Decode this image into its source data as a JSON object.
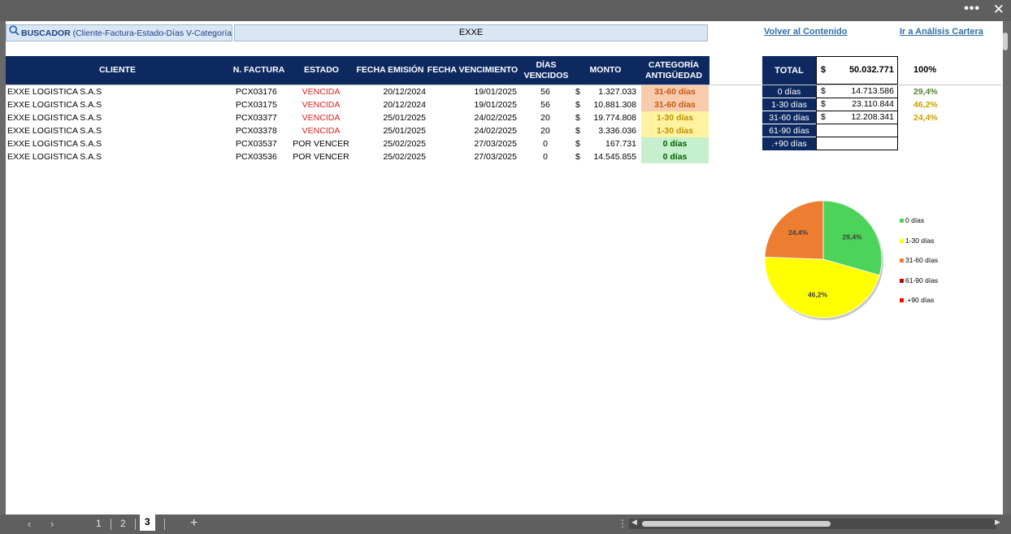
{
  "window": {
    "more_label": "•••",
    "close_label": "✕"
  },
  "search": {
    "label_bold": "BUSCADOR",
    "label_rest": " (Cliente-Factura-Estado-Días V-Categoría)",
    "value": "EXXE"
  },
  "links": {
    "back": "Volver al Contenido",
    "analysis": "Ir a Análisis Cartera"
  },
  "table": {
    "headers": {
      "cliente": "CLIENTE",
      "factura": "N. FACTURA",
      "estado": "ESTADO",
      "emision": "FECHA EMISIÓN",
      "vencimiento": "FECHA VENCIMIENTO",
      "dias": "DÍAS VENCIDOS",
      "monto": "MONTO",
      "categoria": "CATEGORÍA ANTIGÜEDAD"
    },
    "rows": [
      {
        "cliente": "EXXE LOGISTICA S.A.S",
        "factura": "PCX03176",
        "estado": "VENCIDA",
        "emision": "20/12/2024",
        "vencimiento": "19/01/2025",
        "dias": "56",
        "currency": "$",
        "monto": "1.327.033",
        "categoria": "31-60 días",
        "cat_bg": "#f8cbad",
        "cat_fg": "#c65a11"
      },
      {
        "cliente": "EXXE LOGISTICA S.A.S",
        "factura": "PCX03175",
        "estado": "VENCIDA",
        "emision": "20/12/2024",
        "vencimiento": "19/01/2025",
        "dias": "56",
        "currency": "$",
        "monto": "10.881.308",
        "categoria": "31-60 días",
        "cat_bg": "#f8cbad",
        "cat_fg": "#c65a11"
      },
      {
        "cliente": "EXXE LOGISTICA S.A.S",
        "factura": "PCX03377",
        "estado": "VENCIDA",
        "emision": "25/01/2025",
        "vencimiento": "24/02/2025",
        "dias": "20",
        "currency": "$",
        "monto": "19.774.808",
        "categoria": "1-30 días",
        "cat_bg": "#fff2a0",
        "cat_fg": "#bf9000"
      },
      {
        "cliente": "EXXE LOGISTICA S.A.S",
        "factura": "PCX03378",
        "estado": "VENCIDA",
        "emision": "25/01/2025",
        "vencimiento": "24/02/2025",
        "dias": "20",
        "currency": "$",
        "monto": "3.336.036",
        "categoria": "1-30 días",
        "cat_bg": "#fff2a0",
        "cat_fg": "#bf9000"
      },
      {
        "cliente": "EXXE LOGISTICA S.A.S",
        "factura": "PCX03537",
        "estado": "POR VENCER",
        "emision": "25/02/2025",
        "vencimiento": "27/03/2025",
        "dias": "0",
        "currency": "$",
        "monto": "167.731",
        "categoria": "0 días",
        "cat_bg": "#c6efce",
        "cat_fg": "#006100"
      },
      {
        "cliente": "EXXE LOGISTICA S.A.S",
        "factura": "PCX03536",
        "estado": "POR VENCER",
        "emision": "25/02/2025",
        "vencimiento": "27/03/2025",
        "dias": "0",
        "currency": "$",
        "monto": "14.545.855",
        "categoria": "0 días",
        "cat_bg": "#c6efce",
        "cat_fg": "#006100"
      }
    ]
  },
  "summary": {
    "total_label": "TOTAL",
    "currency": "$",
    "total_value": "50.032.771",
    "total_pct": "100%",
    "rows": [
      {
        "label": "0 días",
        "currency": "$",
        "value": "14.713.586",
        "pct": "29,4%",
        "pct_color": "#548235"
      },
      {
        "label": "1-30 días",
        "currency": "$",
        "value": "23.110.844",
        "pct": "46,2%",
        "pct_color": "#c9a000"
      },
      {
        "label": "31-60 días",
        "currency": "$",
        "value": "12.208.341",
        "pct": "24,4%",
        "pct_color": "#c9a000"
      },
      {
        "label": "61-90 días",
        "currency": "",
        "value": "",
        "pct": ""
      },
      {
        "label": ".+90 días",
        "currency": "",
        "value": "",
        "pct": ""
      }
    ]
  },
  "chart_data": {
    "type": "pie",
    "labels": [
      "0 días",
      "1-30 días",
      "31-60 días",
      "61-90 días",
      ".+90 días"
    ],
    "values": [
      29.4,
      46.2,
      24.4,
      0,
      0
    ],
    "data_labels": [
      "29,4%",
      "46,2%",
      "24,4%",
      "",
      ""
    ],
    "colors": [
      "#4cd35a",
      "#ffff00",
      "#ed7d31",
      "#c00000",
      "#ff0000"
    ],
    "legend_position": "right"
  },
  "sheets": {
    "tabs": [
      "1",
      "2",
      "3"
    ],
    "active": "3",
    "add_label": "+"
  }
}
